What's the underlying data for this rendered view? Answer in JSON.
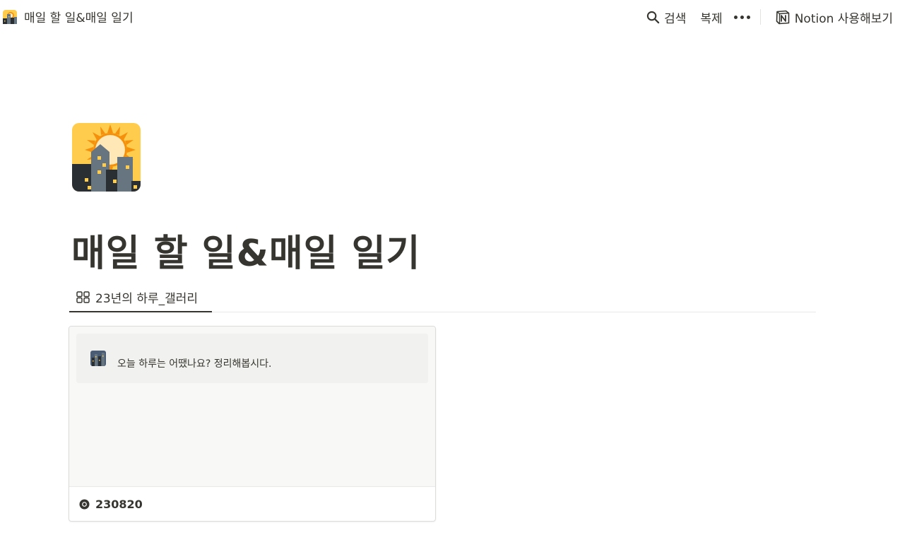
{
  "topbar": {
    "page_icon": "sunrise-over-city-icon",
    "title": "매일 할 일&매일 일기",
    "search_label": "검색",
    "duplicate_label": "복제",
    "more_icon": "more-dots-icon",
    "notion_label": "Notion 사용해보기",
    "notion_icon": "notion-logo-icon"
  },
  "page": {
    "icon": "sunrise-over-city-icon",
    "title": "매일 할 일&매일 일기"
  },
  "view_tabs": [
    {
      "icon": "gallery-icon",
      "label": "23년의 하루_갤러리",
      "active": true
    }
  ],
  "gallery": {
    "cards": [
      {
        "callout_icon": "night-city-icon",
        "callout_text": "오늘 하루는 어땠나요? 정리해봅시다.",
        "name_icon": "record-icon",
        "name": "230820"
      }
    ]
  },
  "colors": {
    "text": "#37352f",
    "divider": "#e9e9e7",
    "callout_bg": "#f1f1ef",
    "preview_bg": "#f8f8f7"
  }
}
